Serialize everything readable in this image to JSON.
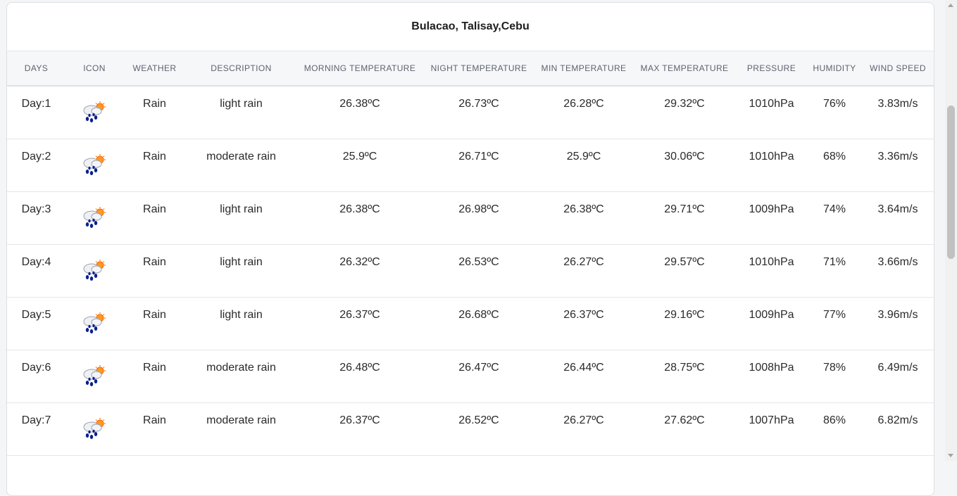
{
  "location": "Bulacao, Talisay,Cebu",
  "columns": [
    "DAYS",
    "ICON",
    "WEATHER",
    "DESCRIPTION",
    "MORNING TEMPERATURE",
    "NIGHT TEMPERATURE",
    "MIN TEMPERATURE",
    "MAX TEMPERATURE",
    "PRESSURE",
    "HUMIDITY",
    "WIND SPEED"
  ],
  "weather_icon": "rain-sun-icon",
  "rows": [
    {
      "day": "Day:1",
      "weather": "Rain",
      "description": "light rain",
      "morning": "26.38ºC",
      "night": "26.73ºC",
      "min": "26.28ºC",
      "max": "29.32ºC",
      "pressure": "1010hPa",
      "humidity": "76%",
      "wind": "3.83m/s"
    },
    {
      "day": "Day:2",
      "weather": "Rain",
      "description": "moderate rain",
      "morning": "25.9ºC",
      "night": "26.71ºC",
      "min": "25.9ºC",
      "max": "30.06ºC",
      "pressure": "1010hPa",
      "humidity": "68%",
      "wind": "3.36m/s"
    },
    {
      "day": "Day:3",
      "weather": "Rain",
      "description": "light rain",
      "morning": "26.38ºC",
      "night": "26.98ºC",
      "min": "26.38ºC",
      "max": "29.71ºC",
      "pressure": "1009hPa",
      "humidity": "74%",
      "wind": "3.64m/s"
    },
    {
      "day": "Day:4",
      "weather": "Rain",
      "description": "light rain",
      "morning": "26.32ºC",
      "night": "26.53ºC",
      "min": "26.27ºC",
      "max": "29.57ºC",
      "pressure": "1010hPa",
      "humidity": "71%",
      "wind": "3.66m/s"
    },
    {
      "day": "Day:5",
      "weather": "Rain",
      "description": "light rain",
      "morning": "26.37ºC",
      "night": "26.68ºC",
      "min": "26.37ºC",
      "max": "29.16ºC",
      "pressure": "1009hPa",
      "humidity": "77%",
      "wind": "3.96m/s"
    },
    {
      "day": "Day:6",
      "weather": "Rain",
      "description": "moderate rain",
      "morning": "26.48ºC",
      "night": "26.47ºC",
      "min": "26.44ºC",
      "max": "28.75ºC",
      "pressure": "1008hPa",
      "humidity": "78%",
      "wind": "6.49m/s"
    },
    {
      "day": "Day:7",
      "weather": "Rain",
      "description": "moderate rain",
      "morning": "26.37ºC",
      "night": "26.52ºC",
      "min": "26.27ºC",
      "max": "27.62ºC",
      "pressure": "1007hPa",
      "humidity": "86%",
      "wind": "6.82m/s"
    }
  ]
}
